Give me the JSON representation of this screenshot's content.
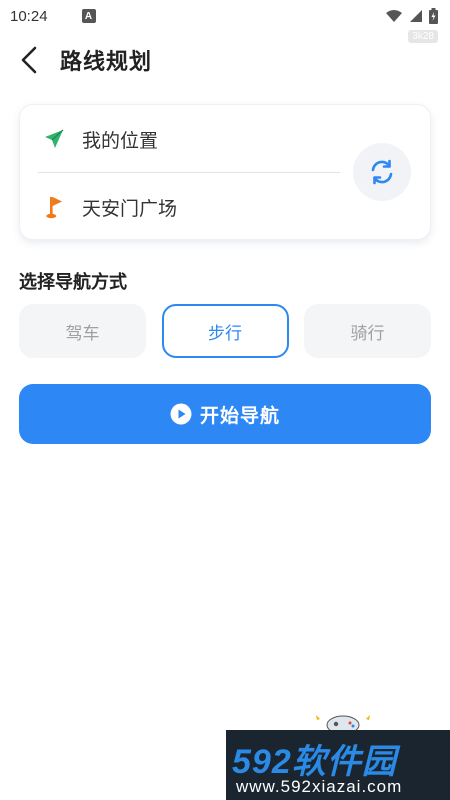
{
  "status_bar": {
    "time": "10:24",
    "notification_icon": "A",
    "speed_badge": "3k28",
    "icons": [
      "wifi-icon",
      "signal-icon",
      "battery-icon"
    ]
  },
  "header": {
    "back_icon": "chevron-left-icon",
    "title": "路线规划"
  },
  "route": {
    "from_label": "我的位置",
    "from_icon": "send-arrow-icon",
    "to_label": "天安门广场",
    "to_icon": "flag-icon",
    "swap_icon": "swap-refresh-icon"
  },
  "modes": {
    "title": "选择导航方式",
    "options": [
      {
        "label": "驾车",
        "active": false
      },
      {
        "label": "步行",
        "active": true
      },
      {
        "label": "骑行",
        "active": false
      }
    ]
  },
  "start": {
    "label": "开始导航",
    "icon": "play-circle-icon"
  },
  "watermark": {
    "brand": "592软件园",
    "site": "www.592xiazai.com"
  },
  "colors": {
    "accent": "#2d88f5",
    "from_icon": "#2fb46a",
    "to_icon": "#f07a1a",
    "watermark_bg": "#1a2530"
  }
}
